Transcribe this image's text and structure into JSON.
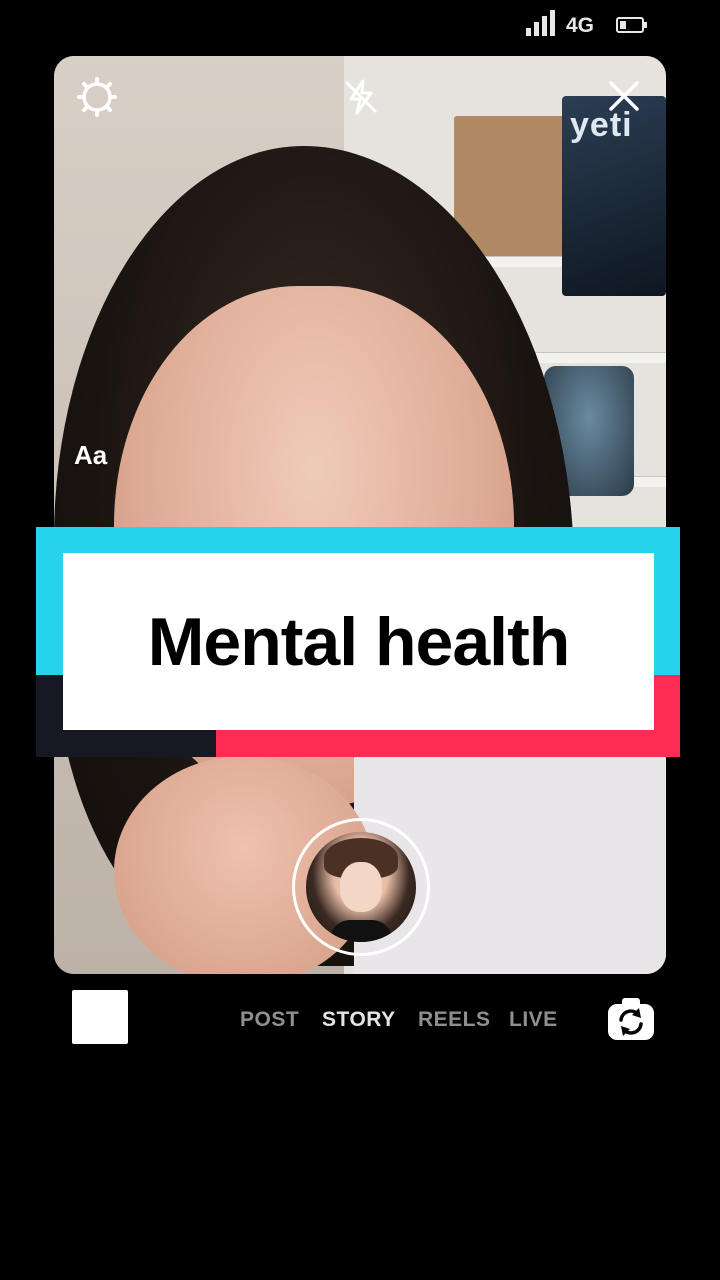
{
  "status_bar": {
    "network": "4G",
    "battery_level": 0.3
  },
  "camera": {
    "overlay_text": "Aa",
    "backdrop_sign": "yeti"
  },
  "caption": {
    "title": "Mental health"
  },
  "colors": {
    "cyan": "#25d4ec",
    "red": "#fe2c55",
    "dark": "#161823",
    "background": "#000000"
  },
  "icons": {
    "settings": "settings-gear-icon",
    "flash": "flash-off-icon",
    "close": "close-icon",
    "flip_camera": "flip-camera-icon"
  },
  "bottom_bar": {
    "modes": [
      {
        "label": "POST",
        "active": false
      },
      {
        "label": "STORY",
        "active": true
      },
      {
        "label": "REELS",
        "active": false
      },
      {
        "label": "LIVE",
        "active": false
      }
    ]
  }
}
